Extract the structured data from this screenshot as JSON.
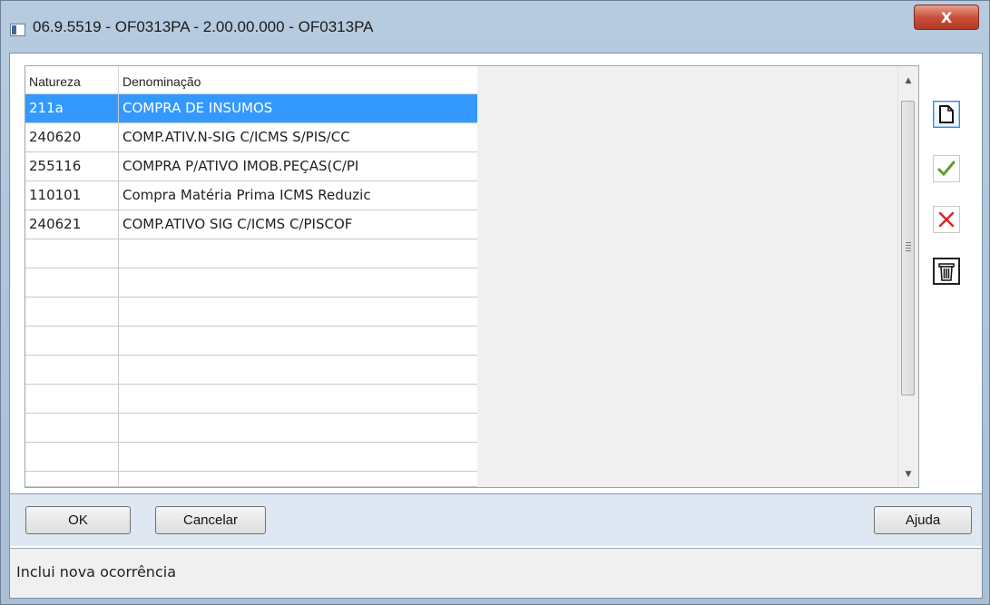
{
  "window": {
    "title": "06.9.5519 - OF0313PA - 2.00.00.000 - OF0313PA",
    "close_label": "X"
  },
  "grid": {
    "columns": [
      "Natureza",
      "Denominação"
    ],
    "rows": [
      {
        "natureza": "211a",
        "denominacao": "COMPRA DE INSUMOS",
        "selected": true
      },
      {
        "natureza": "240620",
        "denominacao": "COMP.ATIV.N-SIG C/ICMS S/PIS/CC"
      },
      {
        "natureza": "255116",
        "denominacao": "COMPRA P/ATIVO IMOB.PEÇAS(C/PI"
      },
      {
        "natureza": "110101",
        "denominacao": "Compra Matéria Prima ICMS Reduzic"
      },
      {
        "natureza": "240621",
        "denominacao": "COMP.ATIVO SIG C/ICMS C/PISCOF"
      }
    ],
    "empty_rows": 8
  },
  "toolbar": {
    "buttons": [
      {
        "name": "new-record-button",
        "icon": "new-document-icon"
      },
      {
        "name": "confirm-button",
        "icon": "checkmark-icon"
      },
      {
        "name": "cancel-edit-button",
        "icon": "red-x-icon"
      },
      {
        "name": "delete-button",
        "icon": "trash-icon"
      }
    ]
  },
  "footer": {
    "ok_label": "OK",
    "cancel_label": "Cancelar",
    "help_label": "Ajuda"
  },
  "status": {
    "text": "Inclui nova ocorrência"
  },
  "colors": {
    "selection": "#3399ff",
    "title_bar": "#b7cbe0",
    "close_button": "#c9503c"
  }
}
